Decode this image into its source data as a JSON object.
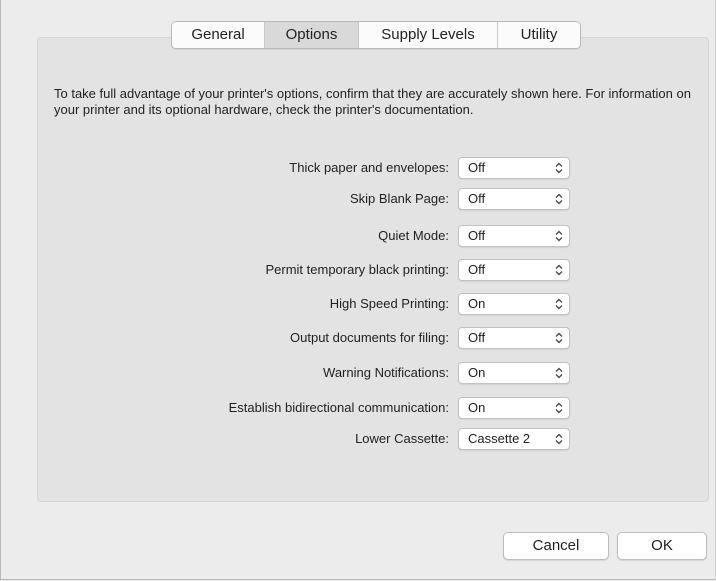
{
  "tabs": [
    {
      "label": "General",
      "selected": false
    },
    {
      "label": "Options",
      "selected": true
    },
    {
      "label": "Supply Levels",
      "selected": false
    },
    {
      "label": "Utility",
      "selected": false
    }
  ],
  "description": "To take full advantage of your printer's options, confirm that they are accurately shown here. For information on your printer and its optional hardware, check the printer's documentation.",
  "options": [
    {
      "label": "Thick paper and envelopes:",
      "value": "Off"
    },
    {
      "label": "Skip Blank Page:",
      "value": "Off"
    },
    {
      "label": "Quiet Mode:",
      "value": "Off"
    },
    {
      "label": "Permit temporary black printing:",
      "value": "Off"
    },
    {
      "label": "High Speed Printing:",
      "value": "On"
    },
    {
      "label": "Output documents for filing:",
      "value": "Off"
    },
    {
      "label": "Warning Notifications:",
      "value": "On"
    },
    {
      "label": "Establish bidirectional communication:",
      "value": "On"
    },
    {
      "label": "Lower Cassette:",
      "value": "Cassette 2"
    }
  ],
  "buttons": {
    "cancel": "Cancel",
    "ok": "OK"
  },
  "icons": {
    "popup": "updown-chevron-icon"
  }
}
